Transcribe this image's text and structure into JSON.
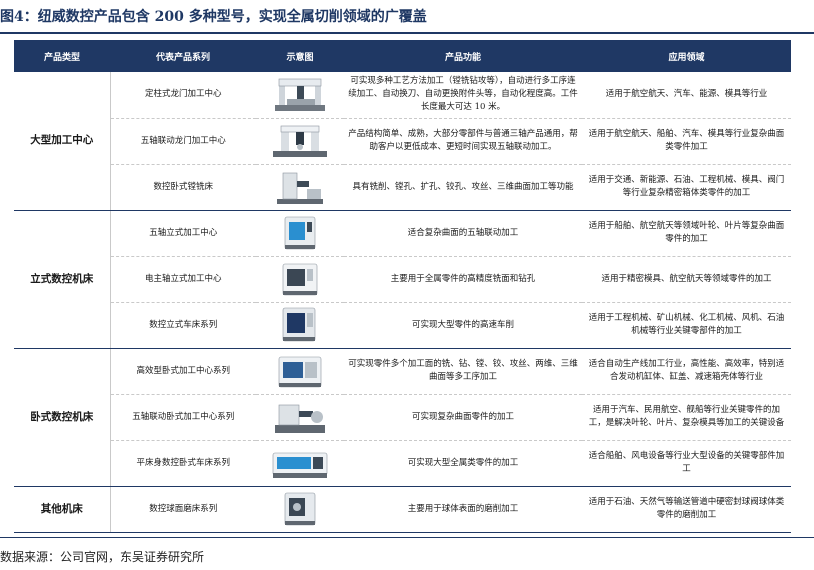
{
  "figure": {
    "title": "图4：纽威数控产品包含 200 多种型号，实现全属切削领域的广覆盖",
    "source": "数据来源：公司官网，东吴证券研究所"
  },
  "table": {
    "headers": [
      "产品类型",
      "代表产品系列",
      "示意图",
      "产品功能",
      "应用领域"
    ],
    "groups": [
      {
        "category": "大型加工中心",
        "rows": [
          {
            "series": "定柱式龙门加工中心",
            "icon": "gantry-machining-center-icon",
            "function": "可实现多种工艺方法加工（镗铣钻攻等），自动进行多工序连续加工、自动换刀、自动更换附件头等，自动化程度高。工件长度最大可达 10 米。",
            "application": "适用于航空航天、汽车、能源、模具等行业"
          },
          {
            "series": "五轴联动龙门加工中心",
            "icon": "five-axis-gantry-icon",
            "function": "产品结构简单、成熟，大部分零部件与普通三轴产品通用，帮助客户以更低成本、更短时间实现五轴联动加工。",
            "application": "适用于航空航天、船舶、汽车、模具等行业复杂曲面类零件加工"
          },
          {
            "series": "数控卧式镗铣床",
            "icon": "boring-milling-machine-icon",
            "function": "具有铣削、镗孔、扩孔、铰孔、攻丝、三维曲面加工等功能",
            "application": "适用于交通、新能源、石油、工程机械、模具、阀门等行业复杂精密箱体类零件的加工"
          }
        ]
      },
      {
        "category": "立式数控机床",
        "rows": [
          {
            "series": "五轴立式加工中心",
            "icon": "five-axis-vertical-icon",
            "function": "适合复杂曲面的五轴联动加工",
            "application": "适用于船舶、航空航天等领域叶轮、叶片等复杂曲面零件的加工"
          },
          {
            "series": "电主轴立式加工中心",
            "icon": "spindle-vertical-icon",
            "function": "主要用于全属零件的高精度铣面和钻孔",
            "application": "适用于精密模具、航空航天等领域零件的加工"
          },
          {
            "series": "数控立式车床系列",
            "icon": "vertical-lathe-icon",
            "function": "可实现大型零件的高速车削",
            "application": "适用于工程机械、矿山机械、化工机械、风机、石油机械等行业关键零部件的加工"
          }
        ]
      },
      {
        "category": "卧式数控机床",
        "rows": [
          {
            "series": "高效型卧式加工中心系列",
            "icon": "horizontal-machining-center-icon",
            "function": "可实现零件多个加工面的铣、钻、镗、铰、攻丝、两维、三维曲面等多工序加工",
            "application": "适合自动生产线加工行业，高性能、高效率，特别适合发动机缸体、缸盖、减速箱壳体等行业"
          },
          {
            "series": "五轴联动卧式加工中心系列",
            "icon": "five-axis-horizontal-icon",
            "function": "可实现复杂曲面零件的加工",
            "application": "适用于汽车、民用航空、舰船等行业关键零件的加工，是解决叶轮、叶片、复杂模具等加工的关键设备"
          },
          {
            "series": "平床身数控卧式车床系列",
            "icon": "flat-bed-lathe-icon",
            "function": "可实现大型全属类零件的加工",
            "application": "适合船舶、风电设备等行业大型设备的关键零部件加工"
          }
        ]
      },
      {
        "category": "其他机床",
        "rows": [
          {
            "series": "数控球面磨床系列",
            "icon": "spherical-grinder-icon",
            "function": "主要用于球体表面的磨削加工",
            "application": "适用于石油、天然气等输送管道中硬密封球阀球体类零件的磨削加工"
          }
        ]
      }
    ]
  }
}
